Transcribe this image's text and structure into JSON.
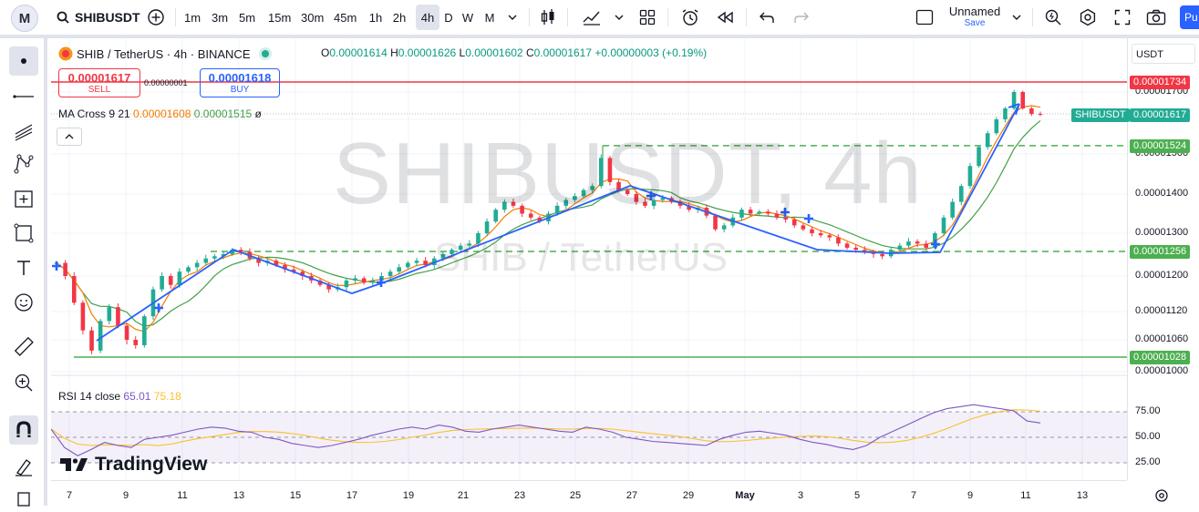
{
  "topbar": {
    "logo": "M",
    "symbol": "SHIBUSDT",
    "intervals": [
      "1m",
      "3m",
      "5m",
      "15m",
      "30m",
      "45m",
      "1h",
      "2h",
      "4h",
      "D",
      "W",
      "M"
    ],
    "active_interval": "4h",
    "layout_name": "Unnamed",
    "save_label": "Save",
    "publish_label": "Pu"
  },
  "legend": {
    "title": "SHIB / TetherUS · 4h · BINANCE",
    "ohlc": {
      "o_label": "O",
      "o": "0.00001614",
      "h_label": "H",
      "h": "0.00001626",
      "l_label": "L",
      "l": "0.00001602",
      "c_label": "C",
      "c": "0.00001617",
      "change": "+0.00000003 (+0.19%)"
    },
    "sell_price": "0.00001617",
    "sell_label": "SELL",
    "spread": "0.00000001",
    "buy_price": "0.00001618",
    "buy_label": "BUY",
    "ma_title": "MA Cross 9 21",
    "ma_fast": "0.00001608",
    "ma_slow": "0.00001515",
    "ma_extra": "ø",
    "rsi_title": "RSI 14 close",
    "rsi_value": "65.01",
    "rsi_ma": "75.18"
  },
  "watermark": {
    "symbol": "SHIBUSDT, 4h",
    "desc": "SHIB / TetherUS"
  },
  "price_axis": {
    "currency": "USDT",
    "labels": [
      {
        "text": "0.00001700",
        "p": 1.7e-05
      },
      {
        "text": "0.00001600",
        "p": 1.6e-05
      },
      {
        "text": "0.00001500",
        "p": 1.5e-05
      },
      {
        "text": "0.00001400",
        "p": 1.4e-05
      },
      {
        "text": "0.00001300",
        "p": 1.3e-05
      },
      {
        "text": "0.00001200",
        "p": 1.2e-05
      },
      {
        "text": "0.00001120",
        "p": 1.12e-05
      },
      {
        "text": "0.00001060",
        "p": 1.06e-05
      },
      {
        "text": "0.00001000",
        "p": 1e-05
      }
    ],
    "tags": [
      {
        "text": "0.00001734",
        "p": 1.734e-05,
        "color": "#f23645"
      },
      {
        "text": "0.00001617",
        "p": 1.617e-05,
        "color": "#22ab94",
        "name": "SHIBUSDT"
      },
      {
        "text": "0.00001524",
        "p": 1.524e-05,
        "color": "#4caf50"
      },
      {
        "text": "0.00001256",
        "p": 1.256e-05,
        "color": "#4caf50"
      },
      {
        "text": "0.00001028",
        "p": 1.028e-05,
        "color": "#4caf50"
      }
    ],
    "rsi_labels": [
      {
        "text": "75.00",
        "v": 75
      },
      {
        "text": "50.00",
        "v": 50
      },
      {
        "text": "25.00",
        "v": 25
      }
    ]
  },
  "time_axis": [
    "7",
    "9",
    "11",
    "13",
    "15",
    "17",
    "19",
    "21",
    "23",
    "25",
    "27",
    "29",
    "May",
    "3",
    "5",
    "7",
    "9",
    "11",
    "13"
  ],
  "chart_data": {
    "type": "candlestick",
    "price_range": [
      9.95e-06,
      1.77e-05
    ],
    "rsi_range": [
      20,
      90
    ],
    "horizontal_levels": [
      1.734e-05,
      1.524e-05,
      1.256e-05,
      1.028e-05
    ],
    "close_path": [
      1.23e-05,
      1.2e-05,
      1.14e-05,
      1.08e-05,
      1.04e-05,
      1.1e-05,
      1.13e-05,
      1.09e-05,
      1.06e-05,
      1.05e-05,
      1.11e-05,
      1.17e-05,
      1.2e-05,
      1.18e-05,
      1.21e-05,
      1.22e-05,
      1.23e-05,
      1.24e-05,
      1.245e-05,
      1.25e-05,
      1.26e-05,
      1.255e-05,
      1.24e-05,
      1.23e-05,
      1.235e-05,
      1.225e-05,
      1.215e-05,
      1.21e-05,
      1.2e-05,
      1.19e-05,
      1.18e-05,
      1.17e-05,
      1.175e-05,
      1.19e-05,
      1.195e-05,
      1.185e-05,
      1.19e-05,
      1.2e-05,
      1.21e-05,
      1.22e-05,
      1.23e-05,
      1.235e-05,
      1.225e-05,
      1.24e-05,
      1.25e-05,
      1.26e-05,
      1.27e-05,
      1.275e-05,
      1.3e-05,
      1.33e-05,
      1.36e-05,
      1.38e-05,
      1.37e-05,
      1.35e-05,
      1.34e-05,
      1.33e-05,
      1.35e-05,
      1.37e-05,
      1.385e-05,
      1.395e-05,
      1.41e-05,
      1.42e-05,
      1.49e-05,
      1.43e-05,
      1.41e-05,
      1.4e-05,
      1.38e-05,
      1.37e-05,
      1.385e-05,
      1.39e-05,
      1.38e-05,
      1.37e-05,
      1.36e-05,
      1.365e-05,
      1.345e-05,
      1.31e-05,
      1.32e-05,
      1.34e-05,
      1.36e-05,
      1.35e-05,
      1.355e-05,
      1.35e-05,
      1.34e-05,
      1.335e-05,
      1.32e-05,
      1.31e-05,
      1.3e-05,
      1.295e-05,
      1.29e-05,
      1.275e-05,
      1.265e-05,
      1.26e-05,
      1.255e-05,
      1.25e-05,
      1.245e-05,
      1.26e-05,
      1.27e-05,
      1.28e-05,
      1.275e-05,
      1.265e-05,
      1.3e-05,
      1.34e-05,
      1.38e-05,
      1.42e-05,
      1.47e-05,
      1.52e-05,
      1.56e-05,
      1.6e-05,
      1.64e-05,
      1.7e-05,
      1.64e-05,
      1.62e-05,
      1.617e-05
    ],
    "rsi_path": [
      58,
      40,
      32,
      38,
      45,
      42,
      40,
      48,
      50,
      52,
      55,
      58,
      60,
      59,
      56,
      55,
      50,
      48,
      44,
      42,
      40,
      42,
      45,
      48,
      52,
      55,
      58,
      60,
      58,
      62,
      60,
      56,
      55,
      58,
      60,
      62,
      60,
      58,
      56,
      55,
      60,
      58,
      55,
      50,
      48,
      46,
      45,
      44,
      43,
      42,
      48,
      52,
      55,
      56,
      54,
      52,
      48,
      45,
      43,
      40,
      38,
      42,
      50,
      56,
      62,
      68,
      74,
      78,
      80,
      82,
      80,
      78,
      76,
      66,
      64
    ]
  }
}
